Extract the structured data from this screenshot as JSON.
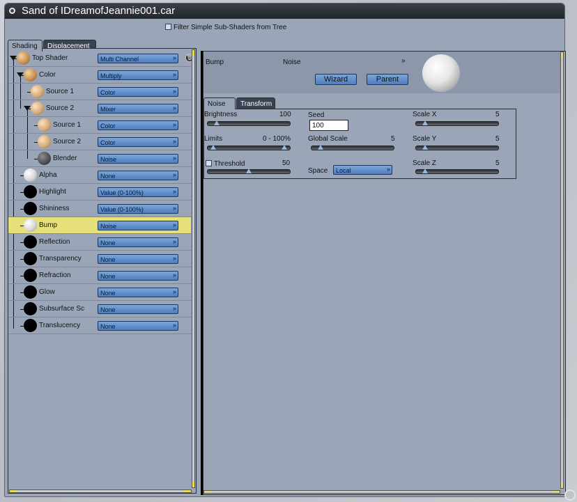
{
  "window": {
    "title": "Sand of IDreamofJeannie001.car"
  },
  "filter": {
    "label": "Filter Simple Sub-Shaders from Tree",
    "checked": false
  },
  "left_tabs": [
    {
      "label": "Shading",
      "active": true
    },
    {
      "label": "Displacement",
      "active": false
    }
  ],
  "tree": [
    {
      "label": "Top Shader",
      "value": "Multi Channel",
      "ball": "tan"
    },
    {
      "label": "Color",
      "value": "Multiply",
      "ball": "tan"
    },
    {
      "label": "Source 1",
      "value": "Color",
      "ball": "tan2"
    },
    {
      "label": "Source 2",
      "value": "Mixer",
      "ball": "tan2"
    },
    {
      "label": "Source 1",
      "value": "Color",
      "ball": "tan2"
    },
    {
      "label": "Source 2",
      "value": "Color",
      "ball": "tan2"
    },
    {
      "label": "Blender",
      "value": "Noise",
      "ball": "noise"
    },
    {
      "label": "Alpha",
      "value": "None",
      "ball": "white"
    },
    {
      "label": "Highlight",
      "value": "Value (0-100%)",
      "ball": "black"
    },
    {
      "label": "Shininess",
      "value": "Value (0-100%)",
      "ball": "black"
    },
    {
      "label": "Bump",
      "value": "Noise",
      "ball": "white",
      "selected": true
    },
    {
      "label": "Reflection",
      "value": "None",
      "ball": "black"
    },
    {
      "label": "Transparency",
      "value": "None",
      "ball": "black"
    },
    {
      "label": "Refraction",
      "value": "None",
      "ball": "black"
    },
    {
      "label": "Glow",
      "value": "None",
      "ball": "black"
    },
    {
      "label": "Subsurface Sc",
      "value": "None",
      "ball": "black"
    },
    {
      "label": "Translucency",
      "value": "None",
      "ball": "black"
    }
  ],
  "right": {
    "channel": "Bump",
    "shader": "Noise",
    "wizard_label": "Wizard",
    "parent_label": "Parent",
    "tabs": [
      {
        "label": "Noise",
        "active": true
      },
      {
        "label": "Transform",
        "active": false
      }
    ],
    "brightness": {
      "label": "Brightness",
      "value": "100",
      "level": 0.05
    },
    "limits": {
      "label": "Limits",
      "value": "0 - 100%",
      "level_low": 0.0,
      "level_high": 1.0
    },
    "threshold": {
      "label": "Threshold",
      "value": "50",
      "level": 0.5,
      "checked": false
    },
    "seed": {
      "label": "Seed",
      "value": "100"
    },
    "global_scale": {
      "label": "Global Scale",
      "value": "5",
      "level": 0.05
    },
    "space": {
      "label": "Space",
      "value": "Local"
    },
    "scale_x": {
      "label": "Scale X",
      "value": "5",
      "level": 0.05
    },
    "scale_y": {
      "label": "Scale Y",
      "value": "5",
      "level": 0.05
    },
    "scale_z": {
      "label": "Scale Z",
      "value": "5",
      "level": 0.05
    }
  },
  "colors": {
    "window_bg": "#9aa5b8",
    "selected_row": "#e5e07a",
    "dropdown": "#5b8bcc"
  }
}
